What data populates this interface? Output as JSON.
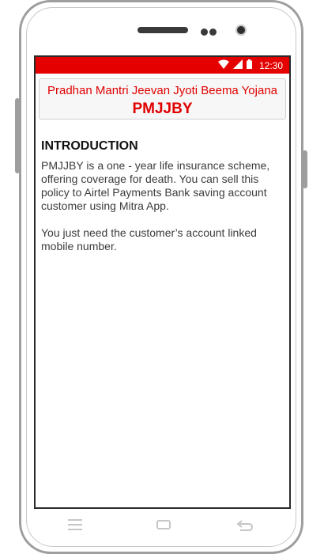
{
  "status_bar": {
    "time": "12:30",
    "icons": [
      "wifi-icon",
      "signal-icon",
      "battery-icon"
    ],
    "color": "#e50000"
  },
  "header_card": {
    "subtitle": "Pradhan Mantri Jeevan Jyoti Beema Yojana",
    "title": "PMJJBY",
    "text_color": "#e00000"
  },
  "content": {
    "heading": "INTRODUCTION",
    "paragraph_1": "PMJJBY is a one - year life insurance scheme, offering coverage for death. You can sell this policy to Airtel Payments Bank saving account customer using Mitra App.",
    "paragraph_2": "You just need the customer’s account linked mobile number."
  },
  "nav_bar": {
    "icons": [
      "menu-icon",
      "home-icon",
      "back-icon"
    ]
  }
}
